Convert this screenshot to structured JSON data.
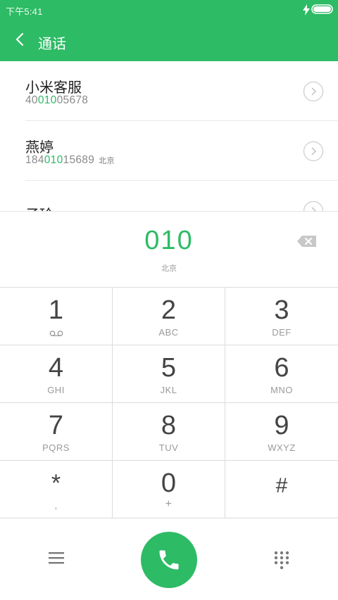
{
  "status_bar": {
    "time": "下午5:41",
    "icons": [
      "charging-icon",
      "battery-icon"
    ]
  },
  "app_bar": {
    "back_icon": "back-arrow-icon",
    "title": "通话"
  },
  "contacts": [
    {
      "name": "小米客服",
      "number_prefix": "40",
      "number_match": "010",
      "number_suffix": "05678",
      "location": ""
    },
    {
      "name": "燕婷",
      "number_prefix": "184",
      "number_match": "010",
      "number_suffix": "15689",
      "location": "北京"
    },
    {
      "name": "子玲",
      "number_prefix": "",
      "number_match": "",
      "number_suffix": "",
      "location": ""
    }
  ],
  "dial_display": {
    "number": "010",
    "location": "北京"
  },
  "keypad": [
    {
      "digit": "1",
      "letters": ""
    },
    {
      "digit": "2",
      "letters": "ABC"
    },
    {
      "digit": "3",
      "letters": "DEF"
    },
    {
      "digit": "4",
      "letters": "GHI"
    },
    {
      "digit": "5",
      "letters": "JKL"
    },
    {
      "digit": "6",
      "letters": "MNO"
    },
    {
      "digit": "7",
      "letters": "PQRS"
    },
    {
      "digit": "8",
      "letters": "TUV"
    },
    {
      "digit": "9",
      "letters": "WXYZ"
    },
    {
      "digit": "*",
      "letters": ","
    },
    {
      "digit": "0",
      "letters": "+"
    },
    {
      "digit": "#",
      "letters": ""
    }
  ],
  "bottom_bar": {
    "icons": [
      "menu-icon",
      "phone-icon",
      "dialpad-icon"
    ]
  },
  "colors": {
    "accent": "#2dbb65",
    "digit": "#444444",
    "letters": "#9a9a9a"
  }
}
